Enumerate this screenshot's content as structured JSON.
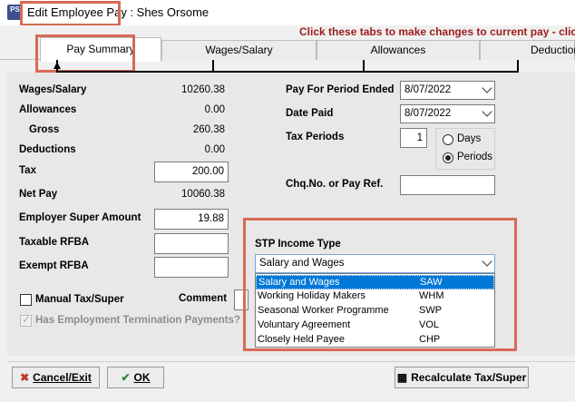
{
  "window": {
    "icon_text": "PS",
    "title": "Edit Employee Pay : Shes Orsome"
  },
  "hint": "Click these tabs to make changes to current pay - click",
  "tabs": [
    {
      "label": "Pay Summary"
    },
    {
      "label": "Wages/Salary"
    },
    {
      "label": "Allowances"
    },
    {
      "label": "Deduction"
    }
  ],
  "left": {
    "wages_label": "Wages/Salary",
    "wages_value": "10260.38",
    "allow_label": "Allowances",
    "allow_value": "0.00",
    "gross_label": "Gross",
    "gross_value": "260.38",
    "deduct_label": "Deductions",
    "deduct_value": "0.00",
    "tax_label": "Tax",
    "tax_value": "200.00",
    "net_label": "Net Pay",
    "net_value": "10060.38",
    "super_label": "Employer Super Amount",
    "super_value": "19.88",
    "taxable_label": "Taxable RFBA",
    "taxable_value": "",
    "exempt_label": "Exempt RFBA",
    "exempt_value": "",
    "manual_label": "Manual Tax/Super",
    "comment_label": "Comment",
    "etp_label": "Has Employment Termination Payments?"
  },
  "right": {
    "period_label": "Pay For Period Ended",
    "period_value": "8/07/2022",
    "date_label": "Date Paid",
    "date_value": "8/07/2022",
    "taxper_label": "Tax Periods",
    "taxper_value": "1",
    "days_label": "Days",
    "periods_label": "Periods",
    "chq_label": "Chq.No. or Pay Ref.",
    "chq_value": ""
  },
  "stp": {
    "label": "STP Income Type",
    "selected": "Salary and Wages",
    "options": [
      {
        "name": "Salary and Wages",
        "code": "SAW"
      },
      {
        "name": "Working Holiday Makers",
        "code": "WHM"
      },
      {
        "name": "Seasonal Worker Programme",
        "code": "SWP"
      },
      {
        "name": "Voluntary Agreement",
        "code": "VOL"
      },
      {
        "name": "Closely Held Payee",
        "code": "CHP"
      }
    ]
  },
  "buttons": {
    "cancel": "Cancel/Exit",
    "ok": "OK",
    "recalc": "Recalculate Tax/Super"
  },
  "colors": {
    "hint": "#9b1c1c",
    "highlight": "#d86a55",
    "selection": "#0078d7"
  }
}
